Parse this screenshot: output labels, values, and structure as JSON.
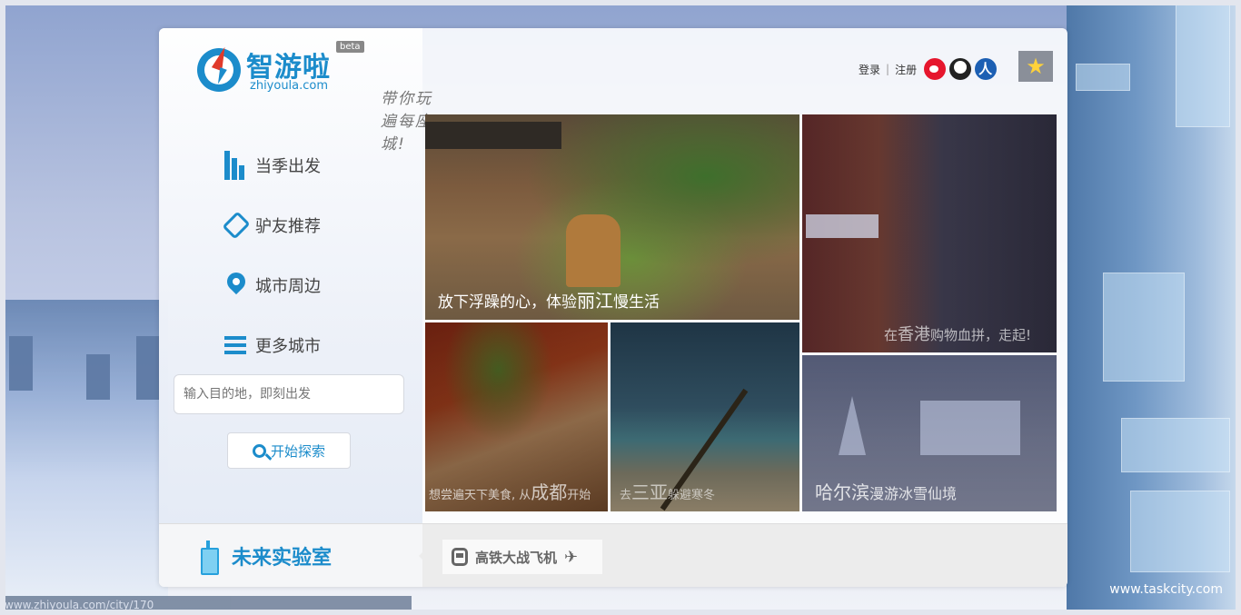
{
  "brand": {
    "name_cn": "智游啦",
    "domain": "zhiyoula.com",
    "beta": "beta",
    "slogan": "带你玩遍每座城!"
  },
  "account": {
    "login": "登录",
    "separator": "|",
    "register": "注册"
  },
  "social_icons": [
    "weibo-icon",
    "qq-icon",
    "renren-icon"
  ],
  "favorite_icon": "star-icon",
  "nav": {
    "items": [
      {
        "icon": "buildings-icon",
        "label": "当季出发"
      },
      {
        "icon": "tag-icon",
        "label": "驴友推荐"
      },
      {
        "icon": "location-pin-icon",
        "label": "城市周边"
      },
      {
        "icon": "list-icon",
        "label": "更多城市"
      }
    ]
  },
  "search": {
    "placeholder": "输入目的地，即刻出发",
    "button_label": "开始探索"
  },
  "tiles": {
    "lijiang": {
      "pre": "放下浮躁的心，体验",
      "city": "丽江",
      "post": "慢生活"
    },
    "hongkong": {
      "pre": "在",
      "city": "香港",
      "post": "购物血拼，走起!"
    },
    "chengdu": {
      "pre": "想尝遍天下美食, 从",
      "city": "成都",
      "post": "开始"
    },
    "sanya": {
      "pre": "去",
      "city": "三亚",
      "post": "躲避寒冬"
    },
    "harbin": {
      "city": "哈尔滨",
      "post": "漫游冰雪仙境"
    }
  },
  "lab": {
    "label": "未来实验室",
    "item": "高铁大战飞机"
  },
  "status_url": "www.zhiyoula.com/city/170",
  "watermark": "www.taskcity.com",
  "colors": {
    "accent": "#1c8ccb",
    "card_bg": "#ffffff",
    "bottom_bar": "#ececec"
  }
}
